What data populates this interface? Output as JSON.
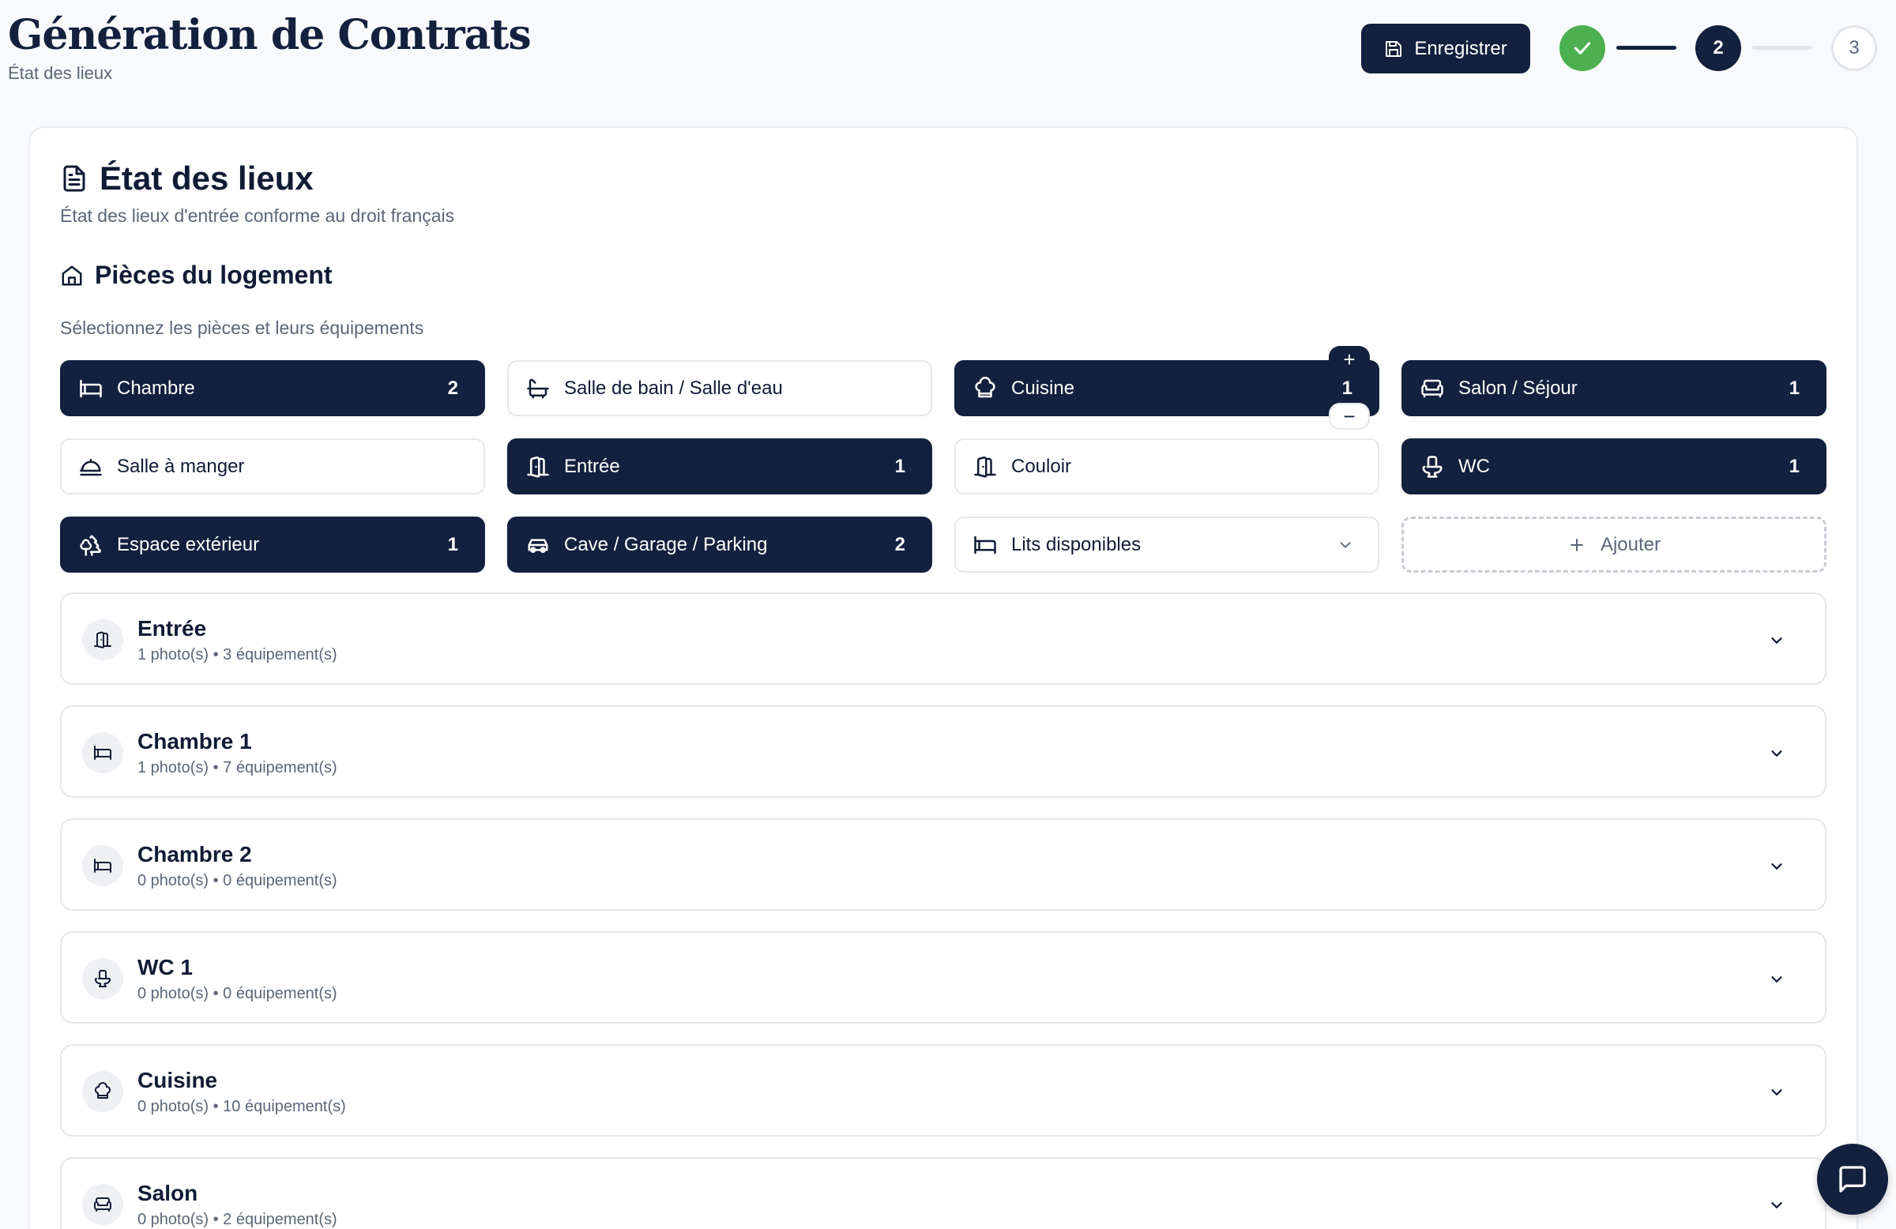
{
  "header": {
    "title": "Génération de Contrats",
    "subtitle": "État des lieux",
    "save_label": "Enregistrer",
    "steps": [
      {
        "label": "",
        "state": "done"
      },
      {
        "label": "2",
        "state": "current"
      },
      {
        "label": "3",
        "state": "todo"
      }
    ]
  },
  "card": {
    "title": "État des lieux",
    "description": "État des lieux d'entrée conforme au droit français",
    "section_title": "Pièces du logement",
    "section_desc": "Sélectionnez les pièces et leurs équipements"
  },
  "room_types": [
    {
      "label": "Chambre",
      "count": "2",
      "selected": true,
      "icon": "bed-icon"
    },
    {
      "label": "Salle de bain / Salle d'eau",
      "count": "",
      "selected": false,
      "icon": "bath-icon"
    },
    {
      "label": "Cuisine",
      "count": "1",
      "selected": true,
      "icon": "chef-hat-icon"
    },
    {
      "label": "Salon / Séjour",
      "count": "1",
      "selected": true,
      "icon": "sofa-icon"
    },
    {
      "label": "Salle à manger",
      "count": "",
      "selected": false,
      "icon": "dining-icon"
    },
    {
      "label": "Entrée",
      "count": "1",
      "selected": true,
      "icon": "door-icon"
    },
    {
      "label": "Couloir",
      "count": "",
      "selected": false,
      "icon": "door-icon"
    },
    {
      "label": "WC",
      "count": "1",
      "selected": true,
      "icon": "toilet-icon"
    },
    {
      "label": "Espace extérieur",
      "count": "1",
      "selected": true,
      "icon": "tree-icon"
    },
    {
      "label": "Cave / Garage / Parking",
      "count": "2",
      "selected": true,
      "icon": "car-icon"
    },
    {
      "label": "Lits disponibles",
      "count": "",
      "selected": false,
      "icon": "bed-icon"
    },
    {
      "label": "Ajouter",
      "count": "",
      "selected": false,
      "icon": "plus-icon"
    }
  ],
  "stepper_controls": {
    "plus": "+",
    "minus": "−"
  },
  "rooms": [
    {
      "name": "Entrée",
      "meta": "1 photo(s) • 3 équipement(s)",
      "icon": "door-icon"
    },
    {
      "name": "Chambre 1",
      "meta": "1 photo(s) • 7 équipement(s)",
      "icon": "bed-icon"
    },
    {
      "name": "Chambre 2",
      "meta": "0 photo(s) • 0 équipement(s)",
      "icon": "bed-icon"
    },
    {
      "name": "WC 1",
      "meta": "0 photo(s) • 0 équipement(s)",
      "icon": "toilet-icon"
    },
    {
      "name": "Cuisine",
      "meta": "0 photo(s) • 10 équipement(s)",
      "icon": "chef-hat-icon"
    },
    {
      "name": "Salon",
      "meta": "0 photo(s) • 2 équipement(s)",
      "icon": "sofa-icon"
    }
  ],
  "colors": {
    "primary": "#13213f",
    "success": "#4caf50",
    "muted": "#5b6678",
    "border": "#e4e7eb"
  }
}
